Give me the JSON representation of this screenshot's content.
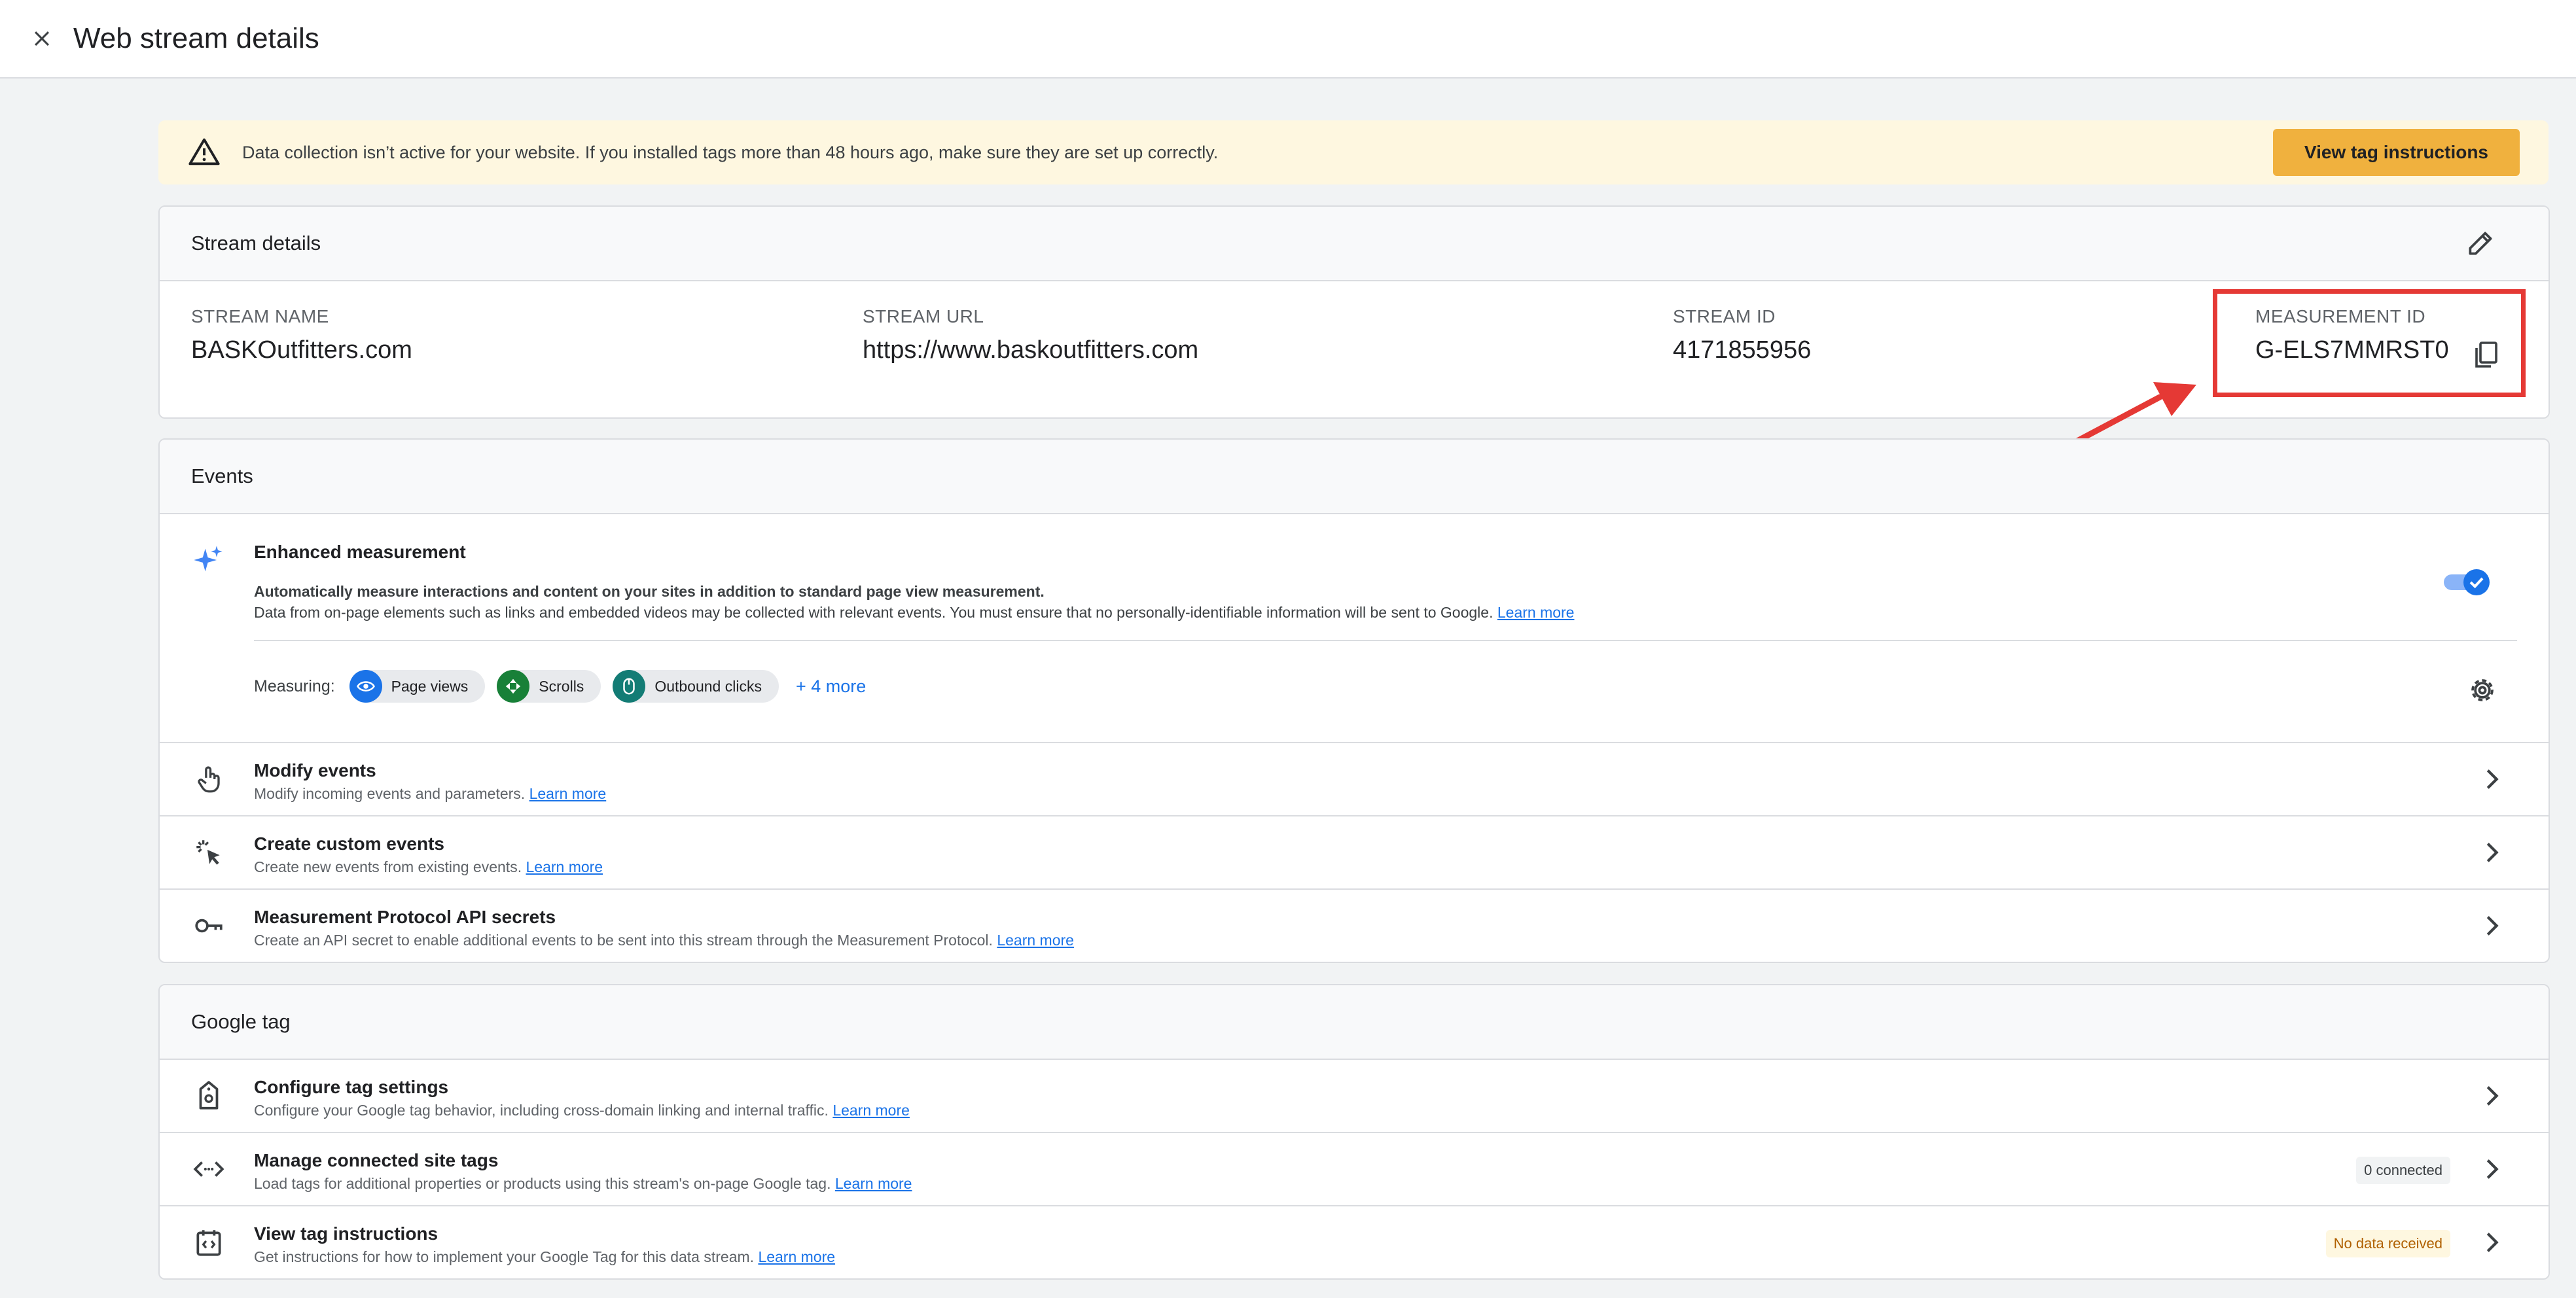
{
  "header": {
    "title": "Web stream details"
  },
  "banner": {
    "message": "Data collection isn’t active for your website. If you installed tags more than 48 hours ago, make sure they are set up correctly.",
    "button_label": "View tag instructions"
  },
  "stream_details": {
    "heading": "Stream details",
    "stream_name": {
      "label": "STREAM NAME",
      "value": "BASKOutfitters.com"
    },
    "stream_url": {
      "label": "STREAM URL",
      "value": "https://www.baskoutfitters.com"
    },
    "stream_id": {
      "label": "STREAM ID",
      "value": "4171855956"
    },
    "measurement_id": {
      "label": "MEASUREMENT ID",
      "value": "G-ELS7MMRST0"
    }
  },
  "events": {
    "heading": "Events",
    "enhanced": {
      "title": "Enhanced measurement",
      "desc1": "Automatically measure interactions and content on your sites in addition to standard page view measurement.",
      "desc2": "Data from on-page elements such as links and embedded videos may be collected with relevant events. You must ensure that no personally-identifiable information will be sent to Google.",
      "learn_more": "Learn more",
      "measuring_label": "Measuring:",
      "chips": [
        "Page views",
        "Scrolls",
        "Outbound clicks"
      ],
      "more": "+ 4 more",
      "toggle_on": true
    },
    "rows": [
      {
        "title": "Modify events",
        "desc": "Modify incoming events and parameters.",
        "link": "Learn more"
      },
      {
        "title": "Create custom events",
        "desc": "Create new events from existing events.",
        "link": "Learn more"
      },
      {
        "title": "Measurement Protocol API secrets",
        "desc": "Create an API secret to enable additional events to be sent into this stream through the Measurement Protocol.",
        "link": "Learn more"
      }
    ]
  },
  "google_tag": {
    "heading": "Google tag",
    "rows": [
      {
        "title": "Configure tag settings",
        "desc": "Configure your Google tag behavior, including cross-domain linking and internal traffic.",
        "link": "Learn more"
      },
      {
        "title": "Manage connected site tags",
        "desc": "Load tags for additional properties or products using this stream's on-page Google tag.",
        "link": "Learn more",
        "badge": "0 connected"
      },
      {
        "title": "View tag instructions",
        "desc": "Get instructions for how to implement your Google Tag for this data stream.",
        "link": "Learn more",
        "badge": "No data received"
      }
    ]
  },
  "colors": {
    "accent": "#1a73e8",
    "banner_button": "#f0b13e",
    "annotation": "#e53935"
  }
}
